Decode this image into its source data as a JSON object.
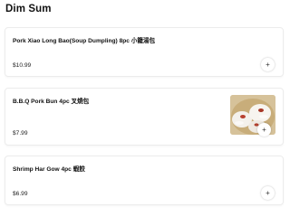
{
  "section": {
    "title": "Dim Sum"
  },
  "items": [
    {
      "name": "Pork Xiao Long Bao(Soup Dumpling) 8pc 小籠湯包",
      "price": "$10.99",
      "add_label": "+"
    },
    {
      "name": "B.B.Q Pork Bun 4pc 叉燒包",
      "price": "$7.99",
      "add_label": "+",
      "image_icon": "bbq-pork-bun-photo"
    },
    {
      "name": "Shrimp Har Gow 4pc 蝦餃",
      "price": "$6.99",
      "add_label": "+"
    }
  ],
  "colors": {
    "background": "#ffffff",
    "card_border": "#ececec",
    "text": "#111111"
  }
}
